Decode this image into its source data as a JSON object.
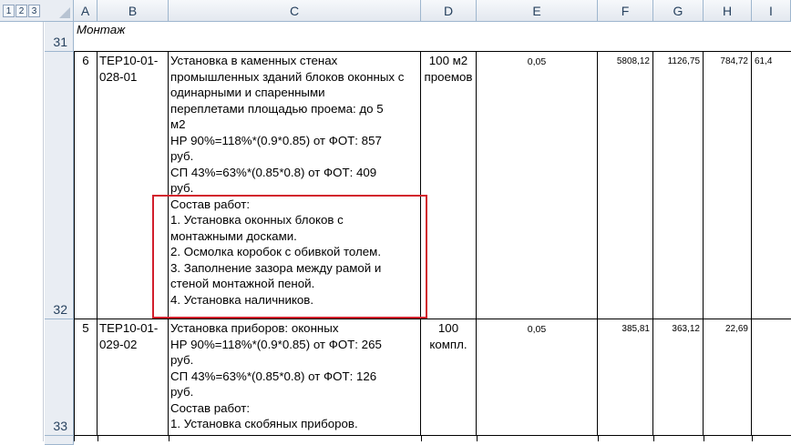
{
  "outline_levels": [
    "1",
    "2",
    "3"
  ],
  "columns": [
    "A",
    "B",
    "C",
    "D",
    "E",
    "F",
    "G",
    "H",
    "I"
  ],
  "rows": {
    "r31": {
      "number": "31",
      "label": "Монтаж"
    },
    "r32": {
      "number": "32",
      "a": "6",
      "b": [
        "ТЕР10-01-",
        "028-01"
      ],
      "c": [
        "Установка в каменных стенах",
        "промышленных зданий блоков оконных с",
        "одинарными и спаренными",
        "переплетами площадью проема: до 5",
        "м2",
        "НР 90%=118%*(0.9*0.85) от ФОТ: 857",
        "руб.",
        "СП 43%=63%*(0.85*0.8) от ФОТ: 409",
        "руб.",
        "Состав работ:",
        "1. Установка оконных блоков с",
        "монтажными досками.",
        "2. Осмолка коробок с обивкой толем.",
        "3. Заполнение зазора между рамой и",
        "стеной монтажной пеной.",
        "4. Установка наличников."
      ],
      "d": [
        "100 м2",
        "проемов"
      ],
      "e": "0,05",
      "f": "5808,12",
      "g": "1126,75",
      "h": "784,72",
      "i": "61,4"
    },
    "r33": {
      "number": "33",
      "a": "5",
      "b": [
        "ТЕР10-01-",
        "029-02"
      ],
      "c": [
        "Установка приборов: оконных",
        "НР 90%=118%*(0.9*0.85) от ФОТ: 265",
        "руб.",
        "СП 43%=63%*(0.85*0.8) от ФОТ: 126",
        "руб.",
        "Состав работ:",
        "1. Установка скобяных приборов."
      ],
      "d": [
        "100",
        "компл."
      ],
      "e": "0,05",
      "f": "385,81",
      "g": "363,12",
      "h": "22,69"
    }
  },
  "highlight_color": "#d21f2c"
}
